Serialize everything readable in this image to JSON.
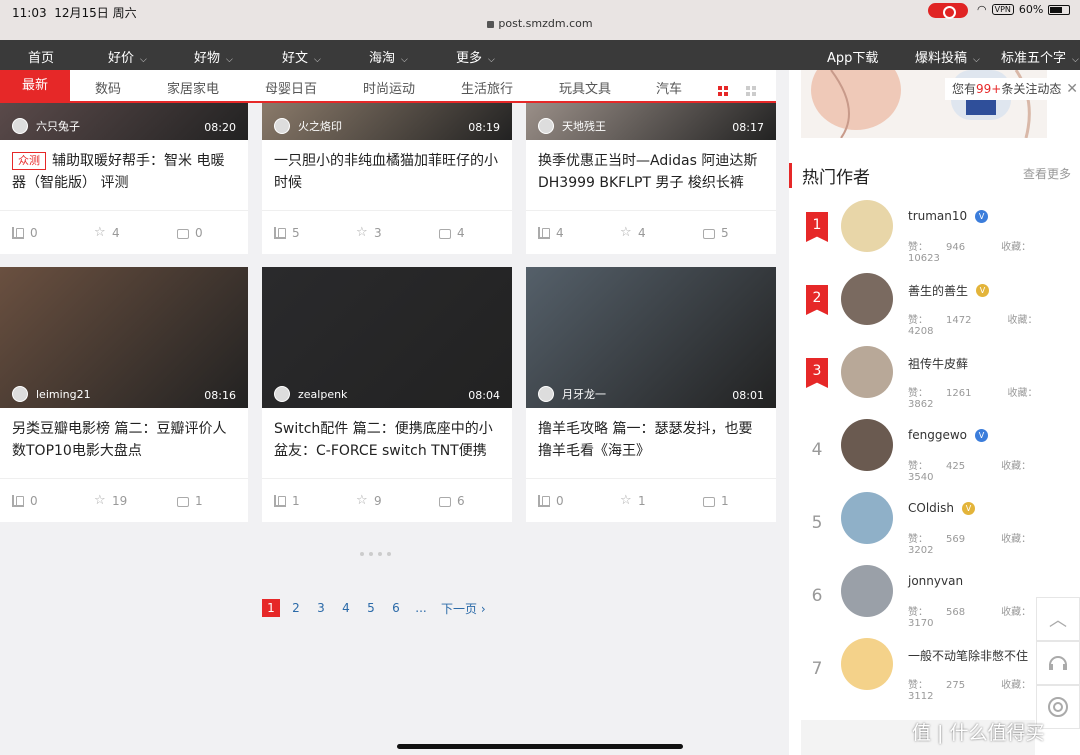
{
  "status_bar": {
    "time": "11:03",
    "date": "12月15日 周六",
    "url": "post.smzdm.com",
    "vpn": "VPN",
    "battery": "60%"
  },
  "top_nav": {
    "items": [
      {
        "label": "首页",
        "has_dropdown": false
      },
      {
        "label": "好价",
        "has_dropdown": true
      },
      {
        "label": "好物",
        "has_dropdown": true
      },
      {
        "label": "好文",
        "has_dropdown": true
      },
      {
        "label": "海淘",
        "has_dropdown": true
      },
      {
        "label": "更多",
        "has_dropdown": true
      }
    ],
    "right_items": [
      {
        "label": "App下载"
      },
      {
        "label": "爆料投稿",
        "has_dropdown": true
      },
      {
        "label": "标准五个字",
        "has_dropdown": true
      }
    ]
  },
  "sub_nav": {
    "tabs": [
      "最新",
      "数码",
      "家居家电",
      "母婴日百",
      "时尚运动",
      "生活旅行",
      "玩具文具",
      "汽车"
    ],
    "active": "最新"
  },
  "cards": [
    {
      "author": "六只兔子",
      "time": "08:20",
      "tag": "众测",
      "title": "辅助取暖好帮手：智米 电暖器（智能版） 评测",
      "likes": "0",
      "favs": "4",
      "comments": "0",
      "img_color": "#5a4a4a"
    },
    {
      "author": "火之烙印",
      "time": "08:19",
      "tag": "",
      "title": "一只胆小的非纯血橘猫加菲旺仔的小时候",
      "likes": "5",
      "favs": "3",
      "comments": "4",
      "img_color": "#8a7a6a"
    },
    {
      "author": "天地残王",
      "time": "08:17",
      "tag": "",
      "title": "换季优惠正当时—Adidas 阿迪达斯 DH3999 BKFLPT 男子 梭织长裤",
      "likes": "4",
      "favs": "4",
      "comments": "5",
      "img_color": "#9a8f88"
    },
    {
      "author": "leiming21",
      "time": "08:16",
      "tag": "",
      "title": "另类豆瓣电影榜 篇二：豆瓣评价人数TOP10电影大盘点",
      "likes": "0",
      "favs": "19",
      "comments": "1",
      "img_color": "#6a5040"
    },
    {
      "author": "zealpenk",
      "time": "08:04",
      "tag": "",
      "title": "Switch配件 篇二：便携底座中的小盆友：C-FORCE switch TNT便携",
      "likes": "1",
      "favs": "9",
      "comments": "6",
      "img_color": "#2a2a2c"
    },
    {
      "author": "月牙龙一",
      "time": "08:01",
      "tag": "",
      "title": "撸羊毛攻略 篇一：瑟瑟发抖，也要撸羊毛看《海王》",
      "likes": "0",
      "favs": "1",
      "comments": "1",
      "img_color": "#55606a"
    }
  ],
  "pagination": {
    "pages": [
      "1",
      "2",
      "3",
      "4",
      "5",
      "6",
      "..."
    ],
    "current": "1",
    "next_label": "下一页"
  },
  "follow_notice": {
    "prefix": "您有",
    "count": "99+",
    "suffix": "条关注动态"
  },
  "hot_authors": {
    "title": "热门作者",
    "more_label": "查看更多",
    "likes_label": "赞：",
    "favs_label": "收藏：",
    "items": [
      {
        "rank": "1",
        "name": "truman10",
        "badge": "blue",
        "likes": "946",
        "favs": "10623"
      },
      {
        "rank": "2",
        "name": "善生的善生",
        "badge": "gold",
        "likes": "1472",
        "favs": "4208"
      },
      {
        "rank": "3",
        "name": "祖传牛皮藓",
        "badge": "",
        "likes": "1261",
        "favs": "3862"
      },
      {
        "rank": "4",
        "name": "fenggewo",
        "badge": "blue",
        "likes": "425",
        "favs": "3540"
      },
      {
        "rank": "5",
        "name": "COldish",
        "badge": "gold",
        "likes": "569",
        "favs": "3202"
      },
      {
        "rank": "6",
        "name": "jonnyvan",
        "badge": "",
        "likes": "568",
        "favs": "3170"
      },
      {
        "rank": "7",
        "name": "一般不动笔除非憋不住",
        "badge": "",
        "likes": "275",
        "favs": "3112"
      }
    ]
  },
  "watermark": "值 | 什么值得买"
}
